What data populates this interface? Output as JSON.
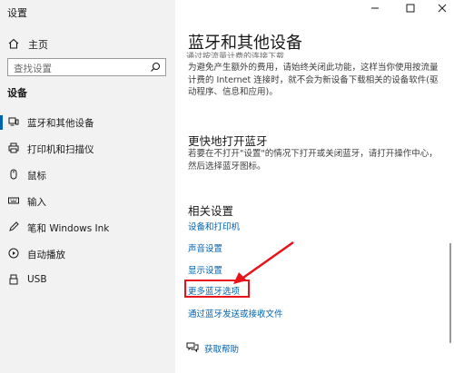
{
  "window": {
    "title": "设置",
    "buttons": [
      "minimize",
      "maximize",
      "close"
    ]
  },
  "sidebar": {
    "home_label": "主页",
    "search_placeholder": "查找设置",
    "section_label": "设备",
    "items": [
      {
        "label": "蓝牙和其他设备",
        "icon": "bluetooth-devices-icon",
        "active": true
      },
      {
        "label": "打印机和扫描仪",
        "icon": "printer-icon",
        "active": false
      },
      {
        "label": "鼠标",
        "icon": "mouse-icon",
        "active": false
      },
      {
        "label": "输入",
        "icon": "keyboard-icon",
        "active": false
      },
      {
        "label": "笔和 Windows Ink",
        "icon": "pen-icon",
        "active": false
      },
      {
        "label": "自动播放",
        "icon": "autoplay-icon",
        "active": false
      },
      {
        "label": "USB",
        "icon": "usb-icon",
        "active": false
      }
    ]
  },
  "main": {
    "title": "蓝牙和其他设备",
    "cut_text": "通过按流量计费的连接下载",
    "metered_description": "为避免产生额外的费用，请始终关闭此功能，这样当你使用按流量计费的 Internet 连接时，就不会为新设备下载相关的设备软件(驱动程序、信息和应用)。",
    "quick_bt_heading": "更快地打开蓝牙",
    "quick_bt_description": "若要在不打开\"设置\"的情况下打开或关闭蓝牙，请打开操作中心，然后选择蓝牙图标。",
    "related_heading": "相关设置",
    "related_links": [
      "设备和打印机",
      "声音设置",
      "显示设置",
      "更多蓝牙选项",
      "通过蓝牙发送或接收文件"
    ],
    "help_link": "获取帮助"
  },
  "colors": {
    "accent": "#0063b1",
    "highlight": "#e8121b",
    "sidebar_bg": "#f2f2f2"
  }
}
